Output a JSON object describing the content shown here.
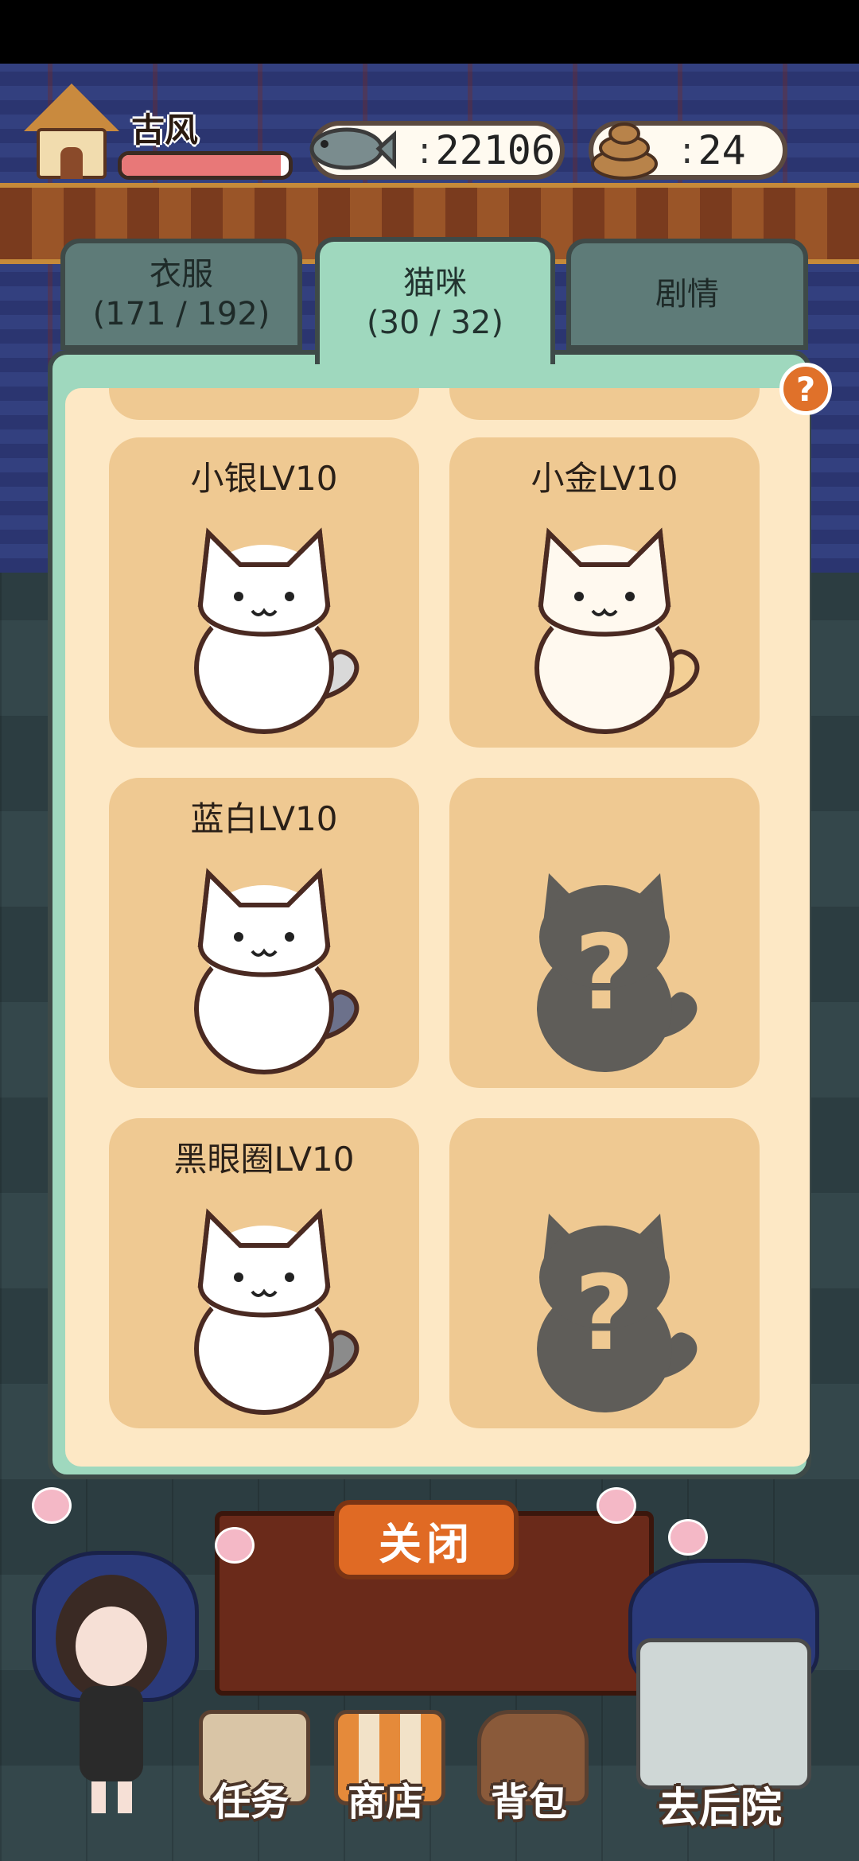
{
  "hud": {
    "player_name": "古风",
    "hp_fraction": 0.95,
    "fish_count": "22106",
    "poop_count": "24",
    "colon": ":"
  },
  "tabs": [
    {
      "label": "衣服",
      "count": "(171 / 192)",
      "active": false
    },
    {
      "label": "猫咪",
      "count": "(30 / 32)",
      "active": true
    },
    {
      "label": "剧情",
      "count": "",
      "active": false
    }
  ],
  "help_icon": "?",
  "cats": [
    {
      "name": "小银LV10",
      "unlocked": true,
      "color": "#ffffff",
      "accent": "#d9d9d9"
    },
    {
      "name": "小金LV10",
      "unlocked": true,
      "color": "#fff9ef",
      "accent": "#f3cf95"
    },
    {
      "name": "蓝白LV10",
      "unlocked": true,
      "color": "#ffffff",
      "accent": "#6c718b"
    },
    {
      "name": "",
      "unlocked": false,
      "color": "#5f5d59",
      "accent": "#efc992"
    },
    {
      "name": "黑眼圈LV10",
      "unlocked": true,
      "color": "#ffffff",
      "accent": "#8b8b8b"
    },
    {
      "name": "",
      "unlocked": false,
      "color": "#5f5d59",
      "accent": "#efc992"
    }
  ],
  "close_label": "关闭",
  "menu": {
    "task": "任务",
    "shop": "商店",
    "bag": "背包",
    "yard": "去后院"
  }
}
